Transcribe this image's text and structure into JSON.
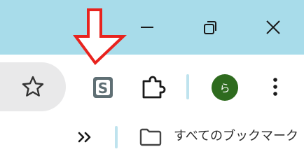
{
  "window": {
    "controls": [
      "minimize-icon",
      "restore-icon",
      "close-icon"
    ],
    "titlebar_color": "#a8dcea"
  },
  "toolbar": {
    "icons": [
      "star-icon",
      "extension-s-icon",
      "puzzle-icon",
      "kebab-menu-icon"
    ],
    "profile": {
      "initial": "ら",
      "color": "#2e6b1e"
    }
  },
  "bookmarks_bar": {
    "overflow_icon": "double-chevron-icon",
    "folder_icon": "folder-icon",
    "all_bookmarks_label": "すべてのブックマーク"
  },
  "annotation": {
    "arrow_color": "#e8231e"
  }
}
